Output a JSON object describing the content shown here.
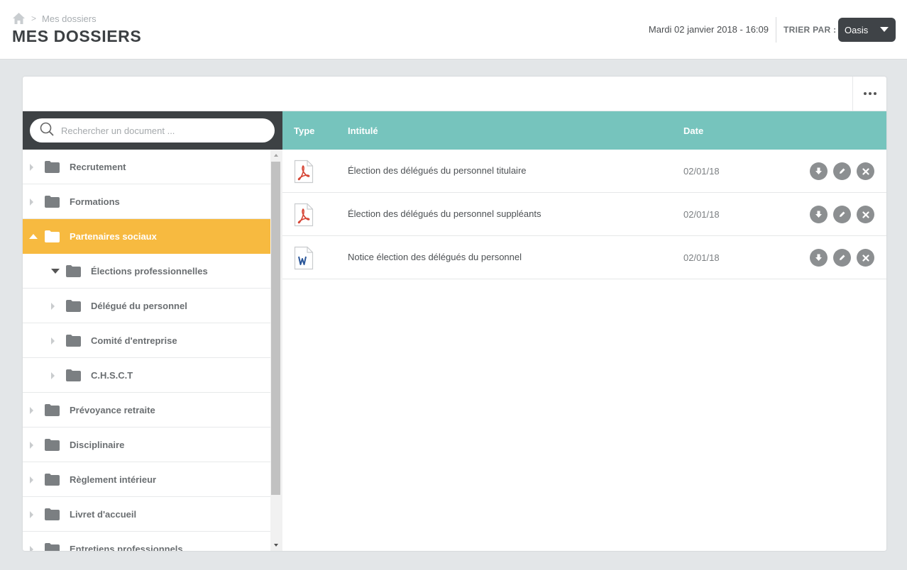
{
  "header": {
    "breadcrumb": "Mes dossiers",
    "title": "MES DOSSIERS",
    "datetime": "Mardi 02 janvier 2018 - 16:09",
    "sort_label": "TRIER PAR :",
    "sort_value": "Oasis"
  },
  "search": {
    "placeholder": "Rechercher un document ..."
  },
  "tree": {
    "items": [
      {
        "label": "Recrutement"
      },
      {
        "label": "Formations"
      },
      {
        "label": "Partenaires sociaux"
      },
      {
        "label": "Élections professionnelles"
      },
      {
        "label": "Délégué du personnel"
      },
      {
        "label": "Comité d'entreprise"
      },
      {
        "label": "C.H.S.C.T"
      },
      {
        "label": "Prévoyance retraite"
      },
      {
        "label": "Disciplinaire"
      },
      {
        "label": "Règlement intérieur"
      },
      {
        "label": "Livret d'accueil"
      },
      {
        "label": "Entretiens professionnels"
      }
    ]
  },
  "table": {
    "columns": {
      "type": "Type",
      "title": "Intitulé",
      "date": "Date"
    },
    "rows": [
      {
        "type": "pdf",
        "title": "Élection des délégués du personnel titulaire",
        "date": "02/01/18"
      },
      {
        "type": "pdf",
        "title": "Élection des délégués du personnel suppléants",
        "date": "02/01/18"
      },
      {
        "type": "word",
        "title": "Notice élection des délégués du personnel",
        "date": "02/01/18"
      }
    ]
  },
  "icons": {
    "home": "home-icon",
    "search": "search-icon",
    "folder": "folder-icon",
    "pdf": "pdf-file-icon",
    "word": "word-file-icon",
    "download": "download-icon",
    "edit": "edit-icon",
    "delete": "delete-icon",
    "more": "more-icon"
  },
  "colors": {
    "accent_active": "#f7ba40",
    "table_header": "#76c4bd",
    "dark": "#3d4144"
  }
}
